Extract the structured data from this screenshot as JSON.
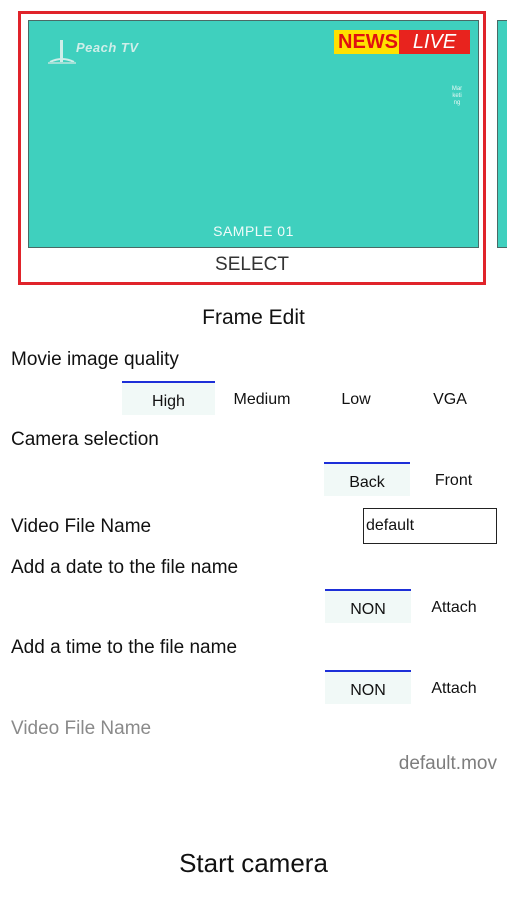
{
  "frame": {
    "logo_text": "Peach TV",
    "news_word": "NEWS",
    "live_word": "LIVE",
    "vertical_text": "Marketing",
    "sample_label": "SAMPLE 01",
    "select_label": "SELECT"
  },
  "frame_edit_label": "Frame Edit",
  "quality": {
    "label": "Movie image quality",
    "options": [
      "High",
      "Medium",
      "Low",
      "VGA"
    ],
    "selected": "High"
  },
  "camera": {
    "label": "Camera selection",
    "options": [
      "Back",
      "Front"
    ],
    "selected": "Back"
  },
  "filename": {
    "label": "Video File Name",
    "value": "default"
  },
  "date_option": {
    "label": "Add a date to the file name",
    "options": [
      "NON",
      "Attach"
    ],
    "selected": "NON"
  },
  "time_option": {
    "label": "Add a time to the file name",
    "options": [
      "NON",
      "Attach"
    ],
    "selected": "NON"
  },
  "result": {
    "label": "Video File Name",
    "value": "default.mov"
  },
  "start_button": "Start camera",
  "colors": {
    "accent_border": "#e0232a",
    "preview_bg": "#3fd0be",
    "segment_indicator": "#1d2fd8"
  }
}
